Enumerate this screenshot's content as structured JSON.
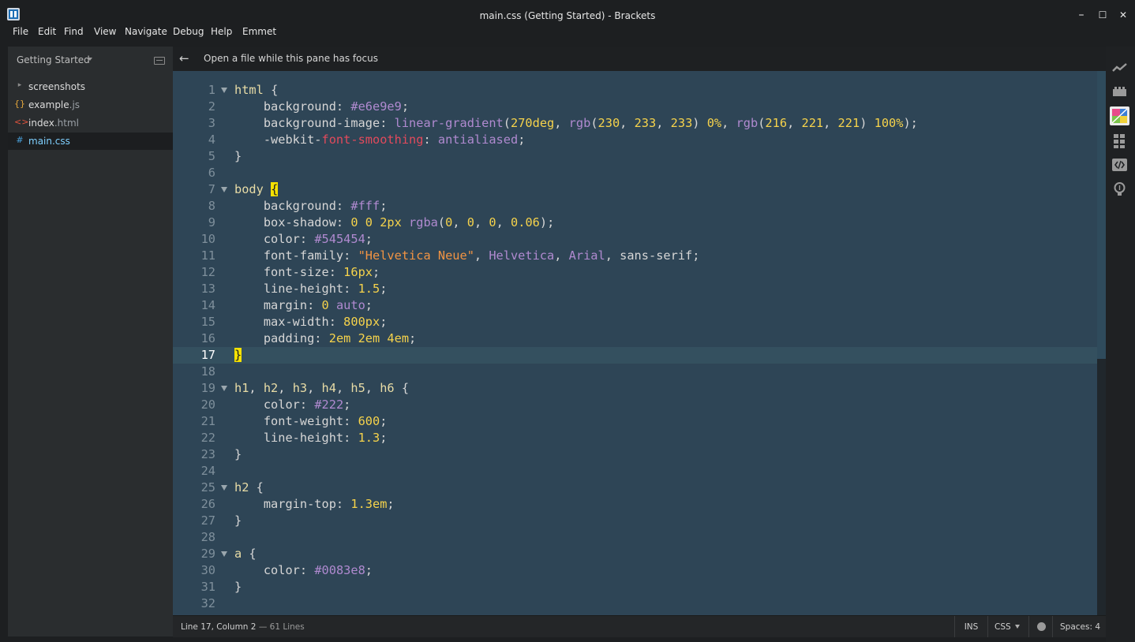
{
  "window": {
    "title": "main.css (Getting Started) - Brackets",
    "controls": {
      "minimize": "–",
      "maximize": "☐",
      "close": "✕"
    }
  },
  "menubar": {
    "items": [
      "File",
      "Edit",
      "Find",
      "View",
      "Navigate",
      "Debug",
      "Help",
      "Emmet"
    ]
  },
  "sidebar": {
    "project": "Getting Started",
    "files": [
      {
        "icon": "folder-icon",
        "glyph": "▸",
        "glyph_color": "#8c8c8c",
        "name": "screenshots",
        "ext": ""
      },
      {
        "icon": "js-file-icon",
        "glyph": "{}",
        "glyph_color": "#e8a93c",
        "name": "example",
        "ext": ".js"
      },
      {
        "icon": "html-file-icon",
        "glyph": "<>",
        "glyph_color": "#e2533d",
        "name": "index",
        "ext": ".html"
      },
      {
        "icon": "css-file-icon",
        "glyph": "#",
        "glyph_color": "#4aa3df",
        "name": "main",
        "ext": ".css",
        "selected": true
      }
    ]
  },
  "pane": {
    "back_arrow": "←",
    "message": "Open a file while this pane has focus"
  },
  "editor": {
    "active_line": 17,
    "lines": [
      "html {",
      "    background: #e6e9e9;",
      "    background-image: linear-gradient(270deg, rgb(230, 233, 233) 0%, rgb(216, 221, 221) 100%);",
      "    -webkit-font-smoothing: antialiased;",
      "}",
      "",
      "body {",
      "    background: #fff;",
      "    box-shadow: 0 0 2px rgba(0, 0, 0, 0.06);",
      "    color: #545454;",
      "    font-family: \"Helvetica Neue\", Helvetica, Arial, sans-serif;",
      "    font-size: 16px;",
      "    line-height: 1.5;",
      "    margin: 0 auto;",
      "    max-width: 800px;",
      "    padding: 2em 2em 4em;",
      "}",
      "",
      "h1, h2, h3, h4, h5, h6 {",
      "    color: #222;",
      "    font-weight: 600;",
      "    line-height: 1.3;",
      "}",
      "",
      "h2 {",
      "    margin-top: 1.3em;",
      "}",
      "",
      "a {",
      "    color: #0083e8;",
      "}",
      ""
    ]
  },
  "statusbar": {
    "cursor": "Line 17, Column 2",
    "line_count": "— 61 Lines",
    "mode": "INS",
    "language": "CSS",
    "spaces": "Spaces: 4"
  },
  "right_toolbar": {
    "icons": [
      "live-preview-icon",
      "extension-manager-icon",
      "color-picker-icon",
      "grid-icon",
      "code-icon",
      "lightbulb-icon"
    ]
  },
  "colors": {
    "editor_bg": "#2e4556",
    "active_line_bg": "#34505f",
    "selector": "#e8dca6",
    "number": "#f6d34b",
    "keyword": "#b08ad0",
    "string": "#f29443",
    "highlight": "#f5e100"
  }
}
